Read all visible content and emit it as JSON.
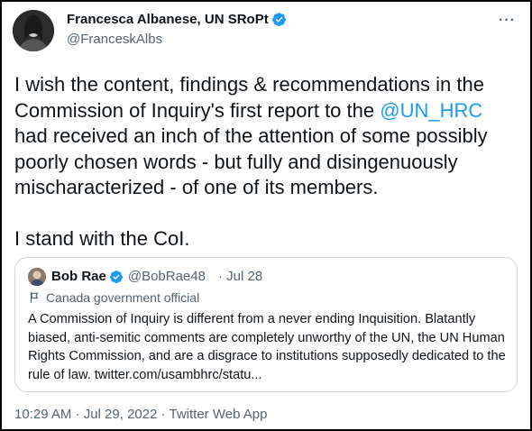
{
  "tweet": {
    "author_name": "Francesca Albanese, UN SRoPt",
    "author_handle": "@FranceskAlbs",
    "more_label": "···",
    "text_before_mention": "I wish the content, findings & recommendations in the Commission of Inquiry's first report to the ",
    "mention": "@UN_HRC",
    "text_after_mention": " had received an inch of the attention of some possibly poorly chosen words - but fully and disingenuously mischaracterized - of one of its members.",
    "text_second_paragraph": "I stand with the CoI.",
    "timestamp": "10:29 AM · Jul 29, 2022 · Twitter Web App"
  },
  "quoted_tweet": {
    "author_name": "Bob Rae",
    "author_handle": "@BobRae48",
    "date": "· Jul 28",
    "label": "Canada government official",
    "text": "A Commission of Inquiry is different from a never ending Inquisition. Blatantly biased, anti-semitic comments are completely unworthy of the UN, the UN Human Rights Commission, and are a disgrace to institutions supposedly dedicated to the rule of law. twitter.com/usambhrc/statu..."
  },
  "colors": {
    "accent": "#1d9bf0",
    "text": "#0f1419",
    "secondary": "#536471",
    "border": "#cfd9de"
  },
  "icons": [
    "verified-badge-icon",
    "more-options-icon",
    "government-flag-icon"
  ]
}
